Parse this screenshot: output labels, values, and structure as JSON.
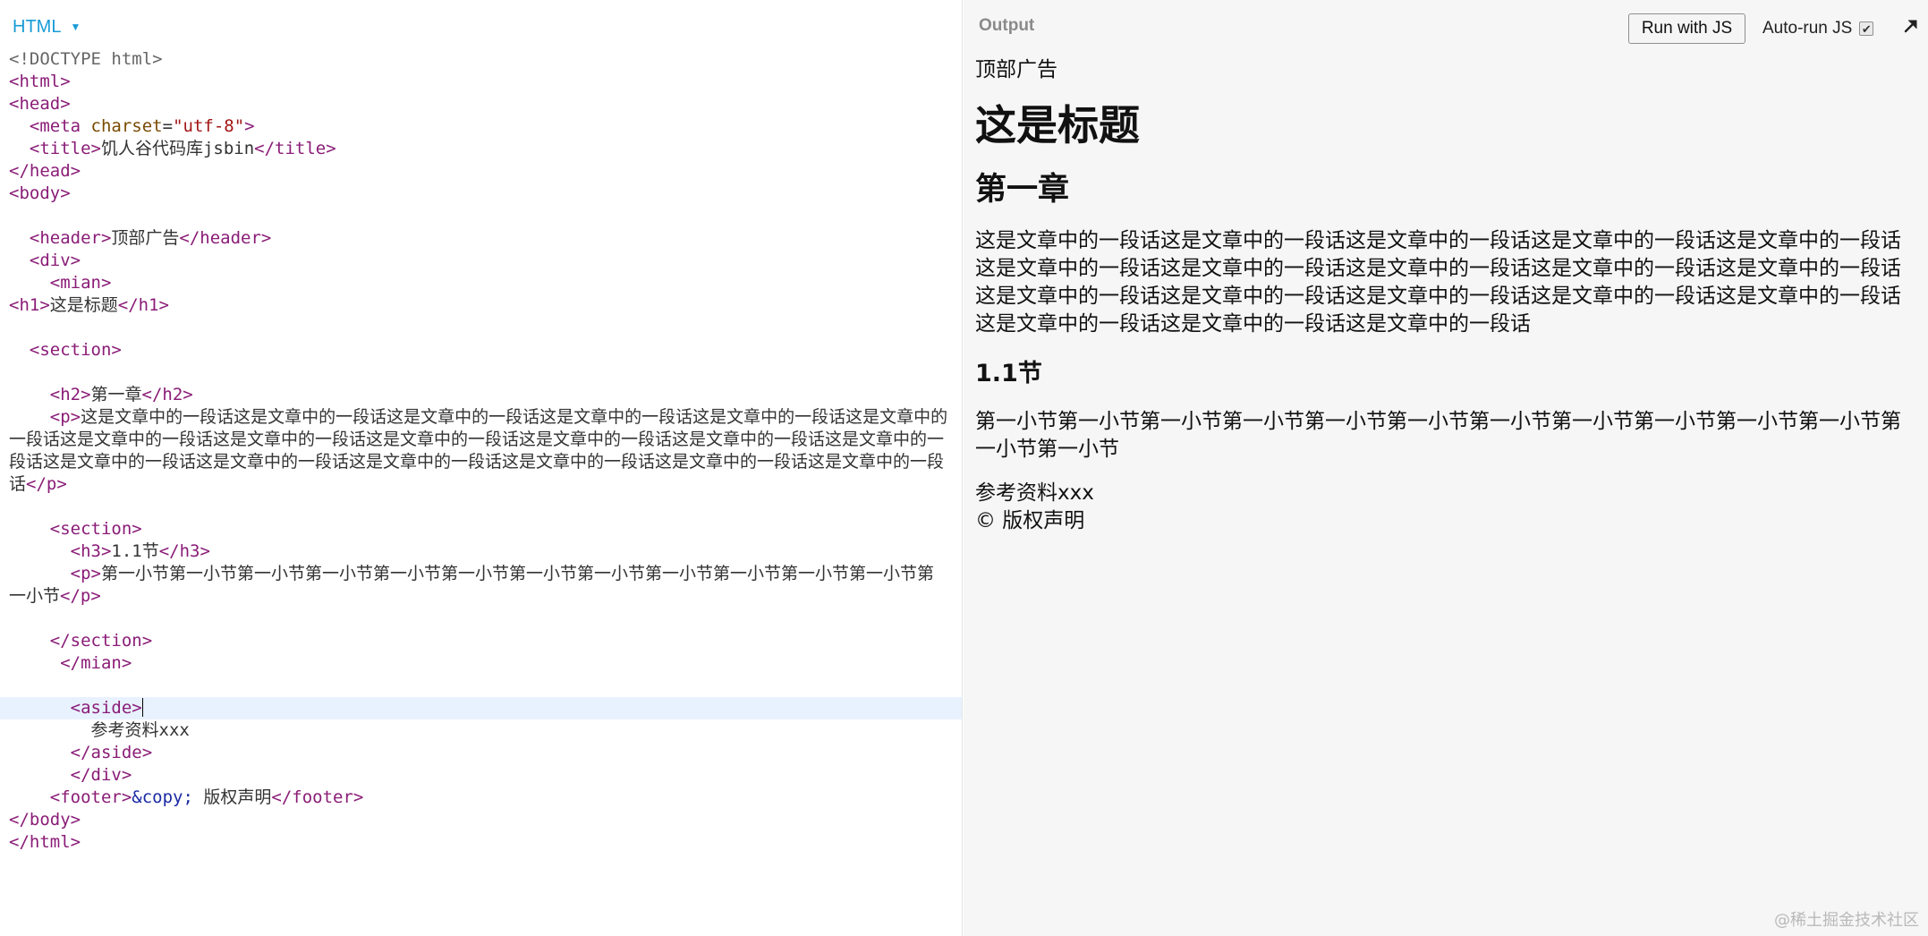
{
  "editor": {
    "panel_label": "HTML",
    "code_lines": [
      [
        {
          "c": "d",
          "t": "<!DOCTYPE html>"
        }
      ],
      [
        {
          "c": "t",
          "t": "<html>"
        }
      ],
      [
        {
          "c": "t",
          "t": "<head>"
        }
      ],
      [
        {
          "c": "",
          "t": "  "
        },
        {
          "c": "t",
          "t": "<meta "
        },
        {
          "c": "a",
          "t": "charset"
        },
        {
          "c": "",
          "t": "="
        },
        {
          "c": "s",
          "t": "\"utf-8\""
        },
        {
          "c": "t",
          "t": ">"
        }
      ],
      [
        {
          "c": "",
          "t": "  "
        },
        {
          "c": "t",
          "t": "<title>"
        },
        {
          "c": "",
          "t": "饥人谷代码库jsbin"
        },
        {
          "c": "t",
          "t": "</title>"
        }
      ],
      [
        {
          "c": "t",
          "t": "</head>"
        }
      ],
      [
        {
          "c": "t",
          "t": "<body>"
        }
      ],
      [],
      [
        {
          "c": "",
          "t": "  "
        },
        {
          "c": "t",
          "t": "<header>"
        },
        {
          "c": "",
          "t": "顶部广告"
        },
        {
          "c": "t",
          "t": "</header>"
        }
      ],
      [
        {
          "c": "",
          "t": "  "
        },
        {
          "c": "t",
          "t": "<div>"
        }
      ],
      [
        {
          "c": "",
          "t": "    "
        },
        {
          "c": "t",
          "t": "<mian>"
        }
      ],
      [
        {
          "c": "t",
          "t": "<h1>"
        },
        {
          "c": "",
          "t": "这是标题"
        },
        {
          "c": "t",
          "t": "</h1>"
        }
      ],
      [],
      [
        {
          "c": "",
          "t": "  "
        },
        {
          "c": "t",
          "t": "<section>"
        }
      ],
      [],
      [
        {
          "c": "",
          "t": "    "
        },
        {
          "c": "t",
          "t": "<h2>"
        },
        {
          "c": "",
          "t": "第一章"
        },
        {
          "c": "t",
          "t": "</h2>"
        }
      ],
      [
        {
          "c": "",
          "t": "    "
        },
        {
          "c": "t",
          "t": "<p>"
        },
        {
          "c": "",
          "t": "这是文章中的一段话这是文章中的一段话这是文章中的一段话这是文章中的一段话这是文章中的一段话这是文章中的一段话这是文章中的一段话这是文章中的一段话这是文章中的一段话这是文章中的一段话这是文章中的一段话这是文章中的一段话这是文章中的一段话这是文章中的一段话这是文章中的一段话这是文章中的一段话这是文章中的一段话这是文章中的一段话"
        },
        {
          "c": "t",
          "t": "</p>"
        }
      ],
      [],
      [
        {
          "c": "",
          "t": "    "
        },
        {
          "c": "t",
          "t": "<section>"
        }
      ],
      [
        {
          "c": "",
          "t": "      "
        },
        {
          "c": "t",
          "t": "<h3>"
        },
        {
          "c": "",
          "t": "1.1节"
        },
        {
          "c": "t",
          "t": "</h3>"
        }
      ],
      [
        {
          "c": "",
          "t": "      "
        },
        {
          "c": "t",
          "t": "<p>"
        },
        {
          "c": "",
          "t": "第一小节第一小节第一小节第一小节第一小节第一小节第一小节第一小节第一小节第一小节第一小节第一小节第一小节"
        },
        {
          "c": "t",
          "t": "</p>"
        }
      ],
      [],
      [
        {
          "c": "",
          "t": "    "
        },
        {
          "c": "t",
          "t": "</section>"
        }
      ],
      [
        {
          "c": "",
          "t": "     "
        },
        {
          "c": "t",
          "t": "</mian>"
        }
      ],
      [],
      [
        {
          "c": "",
          "t": "      "
        },
        {
          "c": "t",
          "t": "<aside>"
        }
      ],
      [
        {
          "c": "",
          "t": "        参考资料xxx"
        }
      ],
      [
        {
          "c": "",
          "t": "      "
        },
        {
          "c": "t",
          "t": "</aside>"
        }
      ],
      [
        {
          "c": "",
          "t": "      "
        },
        {
          "c": "t",
          "t": "</div>"
        }
      ],
      [
        {
          "c": "",
          "t": "    "
        },
        {
          "c": "t",
          "t": "<footer>"
        },
        {
          "c": "e",
          "t": "&copy;"
        },
        {
          "c": "",
          "t": " 版权声明"
        },
        {
          "c": "t",
          "t": "</footer>"
        }
      ],
      [
        {
          "c": "t",
          "t": "</body>"
        }
      ],
      [
        {
          "c": "t",
          "t": "</html>"
        }
      ]
    ],
    "active_line": 25
  },
  "output": {
    "label": "Output",
    "run_button": "Run with JS",
    "autorun_label": "Auto-run JS",
    "autorun_checked": true,
    "rendered": {
      "header": "顶部广告",
      "h1": "这是标题",
      "h2": "第一章",
      "p1": "这是文章中的一段话这是文章中的一段话这是文章中的一段话这是文章中的一段话这是文章中的一段话这是文章中的一段话这是文章中的一段话这是文章中的一段话这是文章中的一段话这是文章中的一段话这是文章中的一段话这是文章中的一段话这是文章中的一段话这是文章中的一段话这是文章中的一段话这是文章中的一段话这是文章中的一段话这是文章中的一段话",
      "h3": "1.1节",
      "p2": "第一小节第一小节第一小节第一小节第一小节第一小节第一小节第一小节第一小节第一小节第一小节第一小节第一小节",
      "aside": "参考资料xxx",
      "footer": "© 版权声明"
    }
  },
  "watermark": "@稀土掘金技术社区",
  "icons": {
    "panel_caret": "caret-down-icon",
    "checkbox": "checkmark-icon",
    "popout": "arrow-up-right-icon"
  }
}
